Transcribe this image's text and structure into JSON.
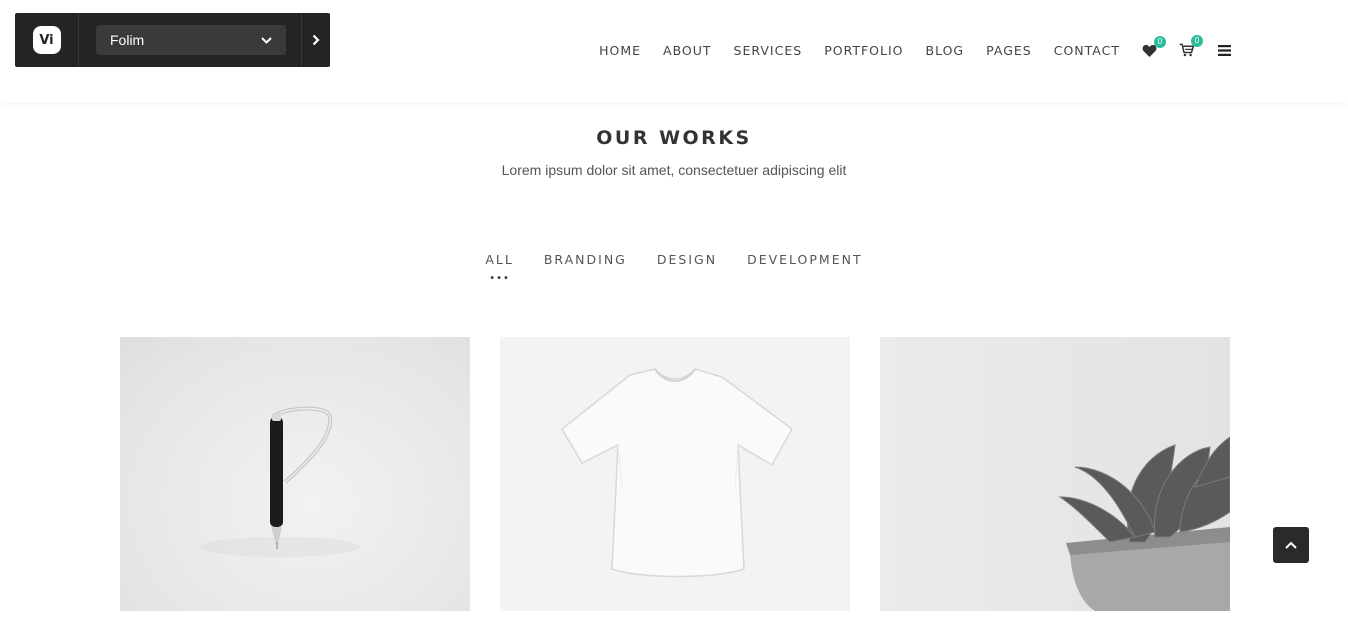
{
  "switcher": {
    "logo_text": "Vi",
    "selected_theme": "Folim"
  },
  "nav": {
    "items": [
      {
        "label": "HOME"
      },
      {
        "label": "ABOUT"
      },
      {
        "label": "SERVICES"
      },
      {
        "label": "PORTFOLIO"
      },
      {
        "label": "BLOG"
      },
      {
        "label": "PAGES"
      },
      {
        "label": "CONTACT"
      }
    ],
    "wishlist_count": "0",
    "cart_count": "0",
    "icons": [
      "heart-icon",
      "cart-icon",
      "menu-icon"
    ]
  },
  "section": {
    "title": "OUR WORKS",
    "subtitle": "Lorem ipsum dolor sit amet, consectetuer adipiscing elit"
  },
  "filters": [
    {
      "label": "ALL",
      "active": true
    },
    {
      "label": "BRANDING"
    },
    {
      "label": "DESIGN"
    },
    {
      "label": "DEVELOPMENT"
    }
  ],
  "colors": {
    "accent": "#2bbd9a",
    "dark": "#242424"
  }
}
